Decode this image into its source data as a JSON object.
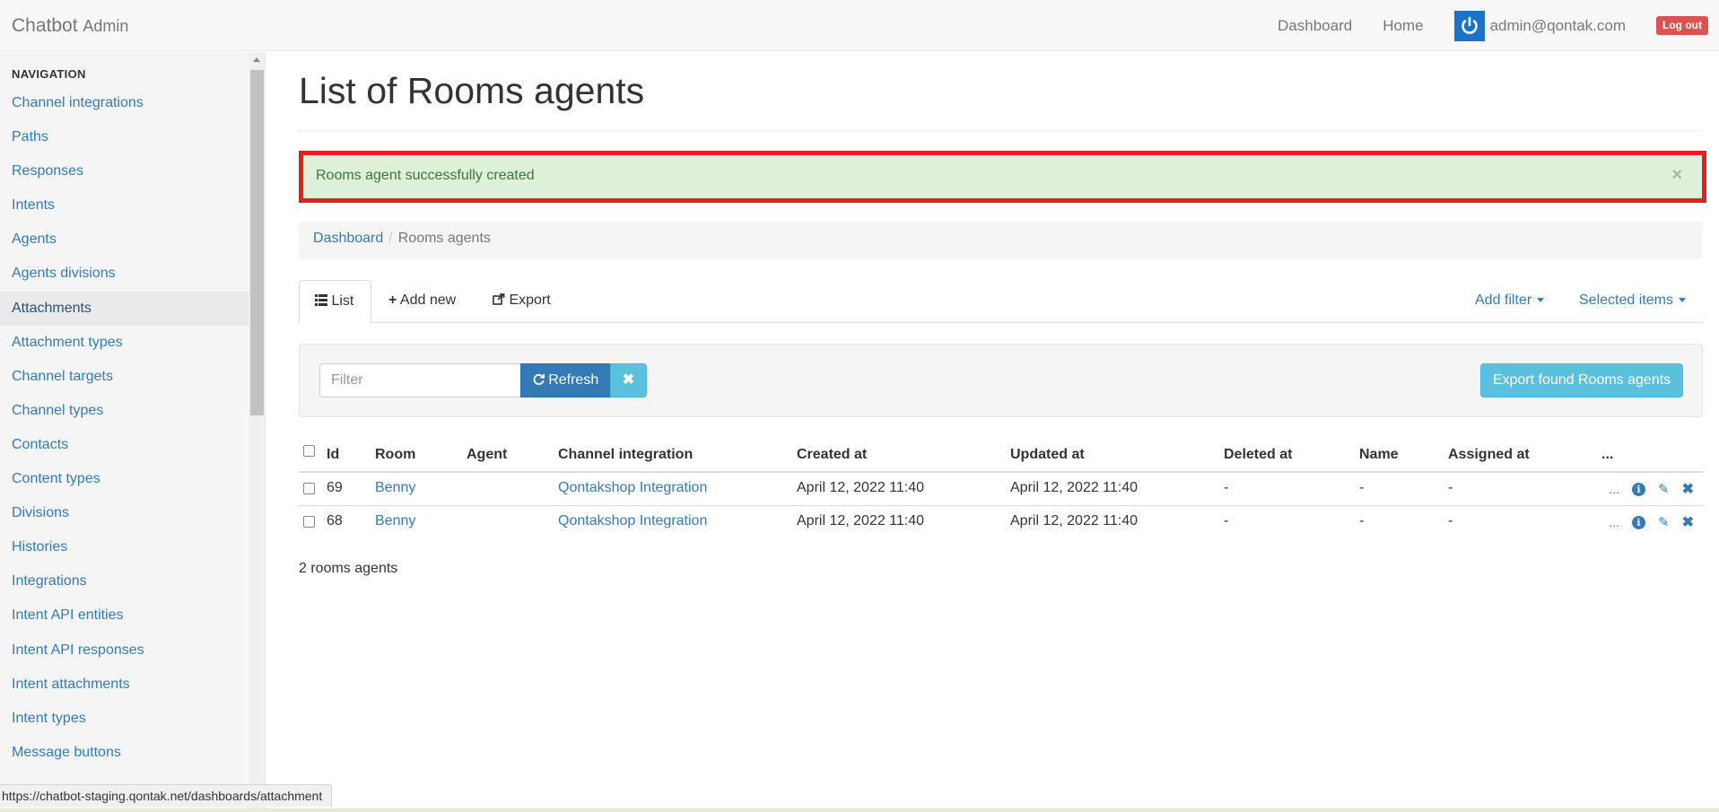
{
  "navbar": {
    "brand": "Chatbot",
    "brand_sub": "Admin",
    "links": [
      "Dashboard",
      "Home"
    ],
    "user_email": "admin@qontak.com",
    "logout_label": "Log out"
  },
  "sidebar": {
    "header": "NAVIGATION",
    "items": [
      {
        "label": "Channel integrations",
        "active": false
      },
      {
        "label": "Paths",
        "active": false
      },
      {
        "label": "Responses",
        "active": false
      },
      {
        "label": "Intents",
        "active": false
      },
      {
        "label": "Agents",
        "active": false
      },
      {
        "label": "Agents divisions",
        "active": false
      },
      {
        "label": "Attachments",
        "active": true
      },
      {
        "label": "Attachment types",
        "active": false
      },
      {
        "label": "Channel targets",
        "active": false
      },
      {
        "label": "Channel types",
        "active": false
      },
      {
        "label": "Contacts",
        "active": false
      },
      {
        "label": "Content types",
        "active": false
      },
      {
        "label": "Divisions",
        "active": false
      },
      {
        "label": "Histories",
        "active": false
      },
      {
        "label": "Integrations",
        "active": false
      },
      {
        "label": "Intent API entities",
        "active": false
      },
      {
        "label": "Intent API responses",
        "active": false
      },
      {
        "label": "Intent attachments",
        "active": false
      },
      {
        "label": "Intent types",
        "active": false
      },
      {
        "label": "Message buttons",
        "active": false
      }
    ]
  },
  "main": {
    "title": "List of Rooms agents",
    "alert": {
      "message": "Rooms agent successfully created",
      "close": "×"
    },
    "breadcrumb": {
      "link": "Dashboard",
      "separator": "/",
      "current": "Rooms agents"
    },
    "tabs": {
      "list": "List",
      "add_new": "Add new",
      "export": "Export"
    },
    "tab_actions": {
      "add_filter": "Add filter",
      "selected_items": "Selected items"
    },
    "filter": {
      "placeholder": "Filter",
      "refresh_label": "Refresh",
      "clear_label": "✖",
      "export_found_label": "Export found Rooms agents"
    },
    "table": {
      "columns": [
        "Id",
        "Room",
        "Agent",
        "Channel integration",
        "Created at",
        "Updated at",
        "Deleted at",
        "Name",
        "Assigned at",
        "..."
      ],
      "rows": [
        {
          "id": "69",
          "room": "Benny",
          "agent": "",
          "channel_integration": "Qontakshop Integration",
          "created_at": "April 12, 2022 11:40",
          "updated_at": "April 12, 2022 11:40",
          "deleted_at": "-",
          "name": "-",
          "assigned_at": "-",
          "more": "..."
        },
        {
          "id": "68",
          "room": "Benny",
          "agent": "",
          "channel_integration": "Qontakshop Integration",
          "created_at": "April 12, 2022 11:40",
          "updated_at": "April 12, 2022 11:40",
          "deleted_at": "-",
          "name": "-",
          "assigned_at": "-",
          "more": "..."
        }
      ]
    },
    "count_text": "2 rooms agents"
  },
  "statusbar": {
    "url": "https://chatbot-staging.qontak.net/dashboards/attachment"
  },
  "colors": {
    "link": "#337ab7",
    "alert_bg": "#dff0d8",
    "alert_border": "#e32020",
    "logout": "#d9534f",
    "info_button": "#5bc0de",
    "primary_button": "#337ab7"
  },
  "icons": {
    "list": "list-icon",
    "add": "plus-icon",
    "export": "share-icon",
    "refresh": "refresh-icon",
    "clear": "remove-icon",
    "info": "info-icon",
    "edit": "pencil-icon",
    "delete": "close-icon",
    "user": "power-icon"
  }
}
